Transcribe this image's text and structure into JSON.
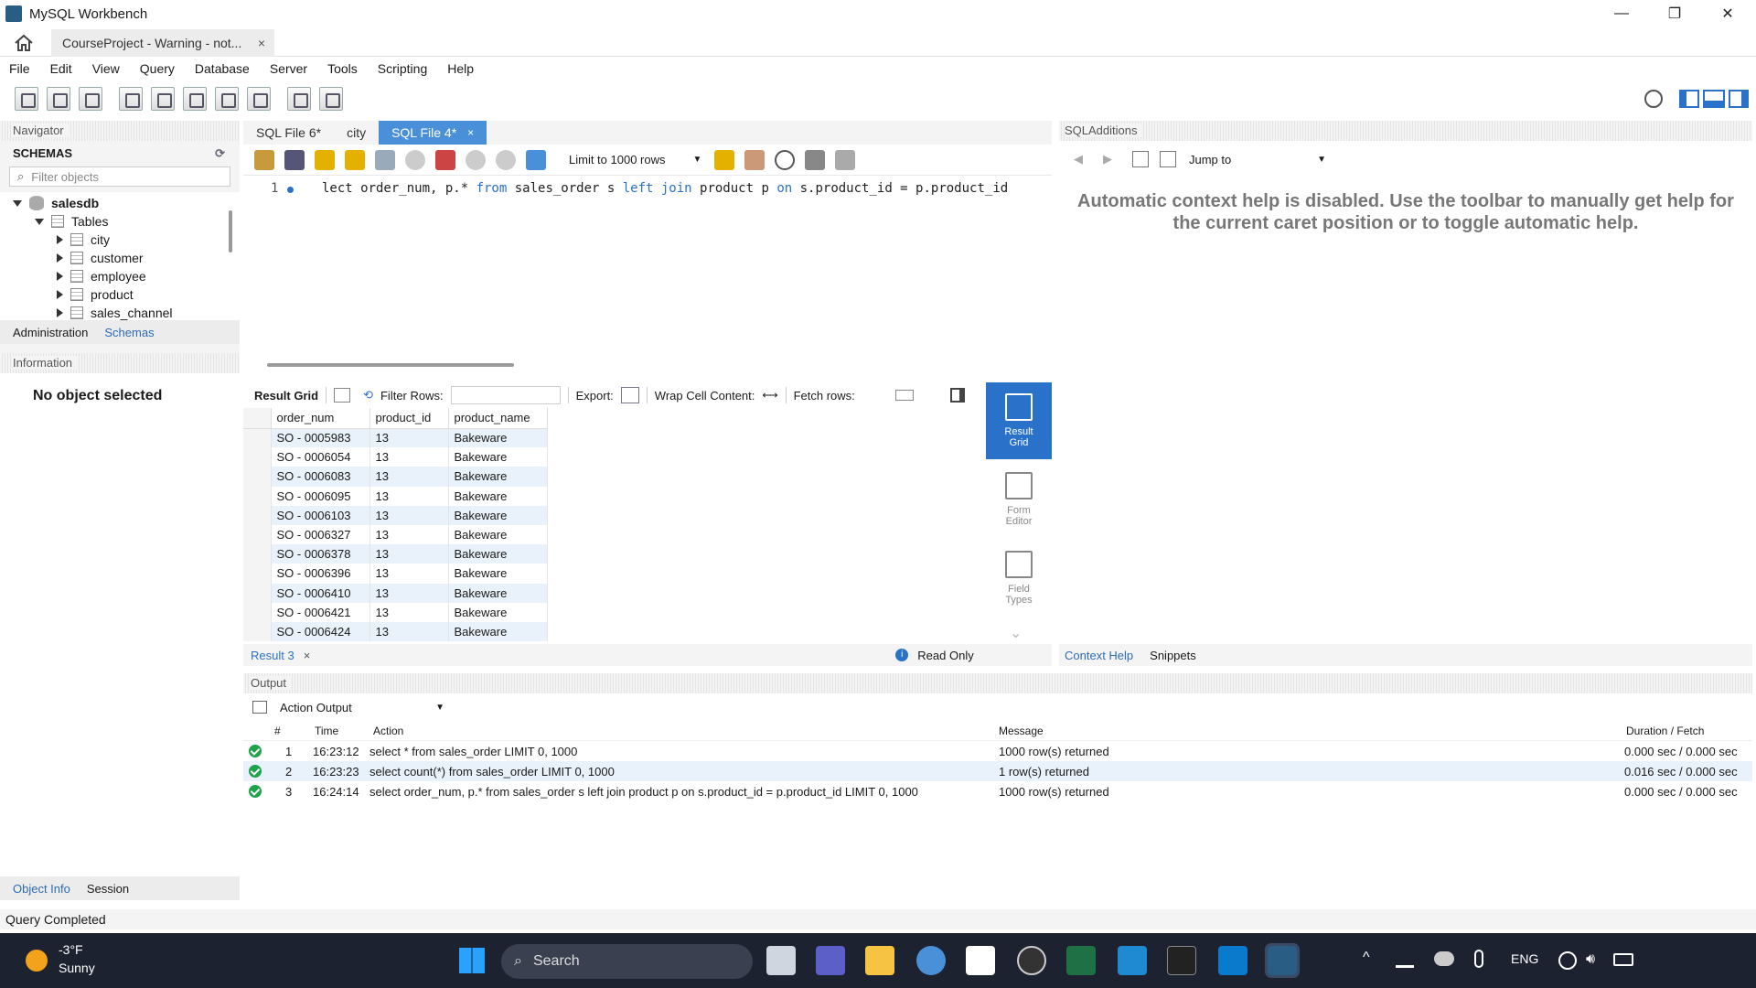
{
  "window": {
    "title": "MySQL Workbench",
    "minimize": "—",
    "restore": "❐",
    "close": "✕"
  },
  "connection_tab": {
    "label": "CourseProject - Warning - not...",
    "close": "×"
  },
  "menu": [
    "File",
    "Edit",
    "View",
    "Query",
    "Database",
    "Server",
    "Tools",
    "Scripting",
    "Help"
  ],
  "navigator": {
    "header": "Navigator",
    "schemas_title": "SCHEMAS",
    "filter_placeholder": "Filter objects",
    "schema": "salesdb",
    "tables_node": "Tables",
    "tables": [
      "city",
      "customer",
      "employee",
      "product",
      "sales_channel"
    ],
    "tabs": [
      "Administration",
      "Schemas"
    ],
    "info_header": "Information",
    "no_object": "No object selected",
    "bottom_tabs": [
      "Object Info",
      "Session"
    ]
  },
  "editor": {
    "tabs": [
      {
        "label": "SQL File 6*",
        "active": false
      },
      {
        "label": "city",
        "active": false
      },
      {
        "label": "SQL File 4*",
        "active": true,
        "close": "×"
      }
    ],
    "limit": "Limit to 1000 rows",
    "line_number": "1",
    "code": {
      "p1": "lect order_num, p.* ",
      "k1": "from",
      "p2": " sales_order s ",
      "k2": "left join",
      "p3": " product p ",
      "k3": "on",
      "p4": " s.product_id = p.product_id"
    }
  },
  "result_toolbar": {
    "result_grid": "Result Grid",
    "filter_rows": "Filter Rows:",
    "export": "Export:",
    "wrap": "Wrap Cell Content:",
    "fetch": "Fetch rows:"
  },
  "grid": {
    "columns": [
      "order_num",
      "product_id",
      "product_name"
    ],
    "rows": [
      [
        "SO - 0005983",
        "13",
        "Bakeware"
      ],
      [
        "SO - 0006054",
        "13",
        "Bakeware"
      ],
      [
        "SO - 0006083",
        "13",
        "Bakeware"
      ],
      [
        "SO - 0006095",
        "13",
        "Bakeware"
      ],
      [
        "SO - 0006103",
        "13",
        "Bakeware"
      ],
      [
        "SO - 0006327",
        "13",
        "Bakeware"
      ],
      [
        "SO - 0006378",
        "13",
        "Bakeware"
      ],
      [
        "SO - 0006396",
        "13",
        "Bakeware"
      ],
      [
        "SO - 0006410",
        "13",
        "Bakeware"
      ],
      [
        "SO - 0006421",
        "13",
        "Bakeware"
      ],
      [
        "SO - 0006424",
        "13",
        "Bakeware"
      ]
    ]
  },
  "side_buttons": {
    "result_grid": "Result Grid",
    "form_editor": "Form Editor",
    "field_types": "Field Types"
  },
  "result_footer": {
    "tab": "Result 3",
    "close": "×",
    "read_only": "Read Only"
  },
  "sql_additions": {
    "header": "SQLAdditions",
    "jump_to": "Jump to",
    "context_text": "Automatic context help is disabled. Use the toolbar to manually get help for the current caret position or to toggle automatic help.",
    "tabs": [
      "Context Help",
      "Snippets"
    ]
  },
  "output": {
    "header": "Output",
    "selector": "Action Output",
    "columns": [
      "#",
      "Time",
      "Action",
      "Message",
      "Duration / Fetch"
    ],
    "rows": [
      {
        "n": "1",
        "time": "16:23:12",
        "action": "select * from sales_order LIMIT 0, 1000",
        "message": "1000 row(s) returned",
        "duration": "0.000 sec / 0.000 sec"
      },
      {
        "n": "2",
        "time": "16:23:23",
        "action": "select count(*) from sales_order LIMIT 0, 1000",
        "message": "1 row(s) returned",
        "duration": "0.016 sec / 0.000 sec"
      },
      {
        "n": "3",
        "time": "16:24:14",
        "action": "select order_num, p.* from sales_order s left join product p on s.product_id = p.product_id LIMIT 0, 1000",
        "message": "1000 row(s) returned",
        "duration": "0.000 sec / 0.000 sec"
      }
    ]
  },
  "status": "Query Completed",
  "taskbar": {
    "temp": "-3°F",
    "weather": "Sunny",
    "search": "Search",
    "lang": "ENG"
  }
}
